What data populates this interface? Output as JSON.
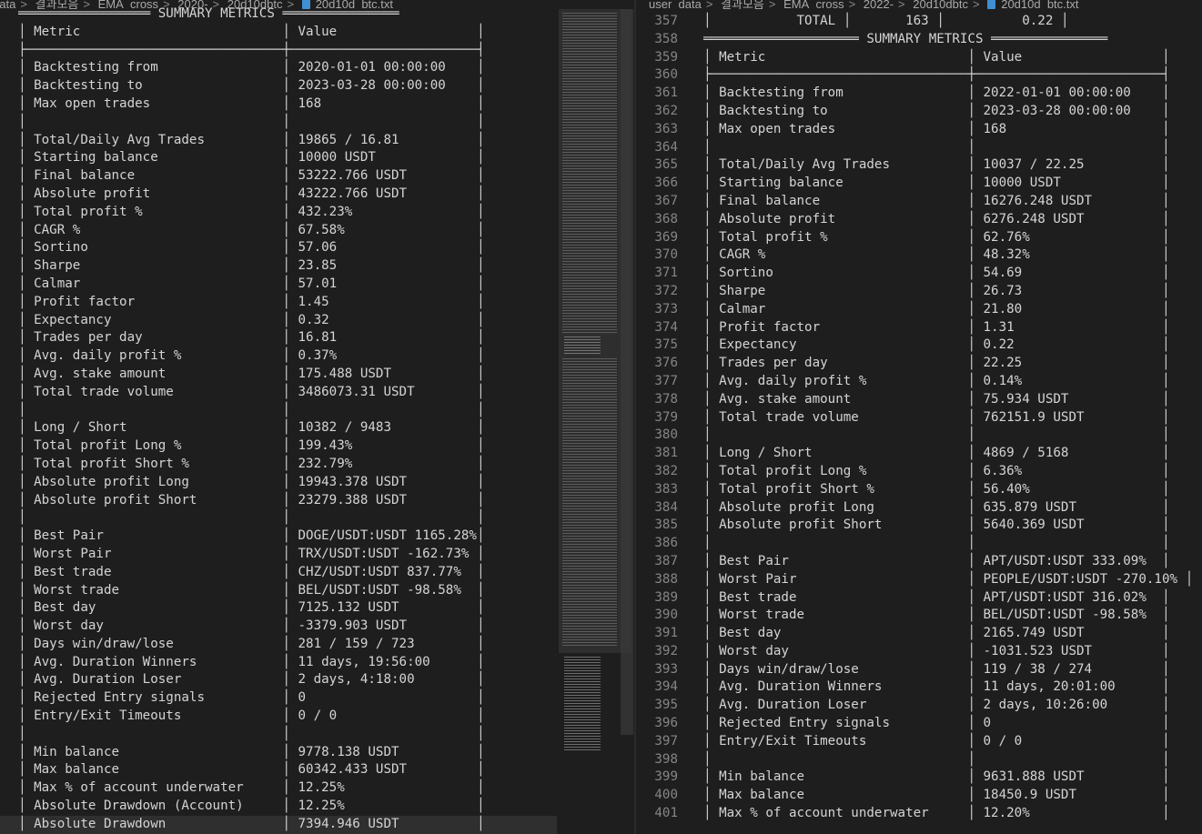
{
  "left_pane": {
    "breadcrumb": [
      "data",
      "결과모음",
      "EMA_cross",
      "2020-",
      "20d10dbtc"
    ],
    "file": "20d10d_btc.txt",
    "lines": [
      "═════════════════ SUMMARY METRICS ═══════════════",
      "│ Metric                          │ Value                  │",
      "├─────────────────────────────────┼────────────────────────┤",
      "│ Backtesting from                │ 2020-01-01 00:00:00    │",
      "│ Backtesting to                  │ 2023-03-28 00:00:00    │",
      "│ Max open trades                 │ 168                    │",
      "│                                 │                        │",
      "│ Total/Daily Avg Trades          │ 19865 / 16.81          │",
      "│ Starting balance                │ 10000 USDT             │",
      "│ Final balance                   │ 53222.766 USDT         │",
      "│ Absolute profit                 │ 43222.766 USDT         │",
      "│ Total profit %                  │ 432.23%                │",
      "│ CAGR %                          │ 67.58%                 │",
      "│ Sortino                         │ 57.06                  │",
      "│ Sharpe                          │ 23.85                  │",
      "│ Calmar                          │ 57.01                  │",
      "│ Profit factor                   │ 1.45                   │",
      "│ Expectancy                      │ 0.32                   │",
      "│ Trades per day                  │ 16.81                  │",
      "│ Avg. daily profit %             │ 0.37%                  │",
      "│ Avg. stake amount               │ 175.488 USDT           │",
      "│ Total trade volume              │ 3486073.31 USDT        │",
      "│                                 │                        │",
      "│ Long / Short                    │ 10382 / 9483           │",
      "│ Total profit Long %             │ 199.43%                │",
      "│ Total profit Short %            │ 232.79%                │",
      "│ Absolute profit Long            │ 19943.378 USDT         │",
      "│ Absolute profit Short           │ 23279.388 USDT         │",
      "│                                 │                        │",
      "│ Best Pair                       │ DOGE/USDT:USDT 1165.28%│",
      "│ Worst Pair                      │ TRX/USDT:USDT -162.73% │",
      "│ Best trade                      │ CHZ/USDT:USDT 837.77%  │",
      "│ Worst trade                     │ BEL/USDT:USDT -98.58%  │",
      "│ Best day                        │ 7125.132 USDT          │",
      "│ Worst day                       │ -3379.903 USDT         │",
      "│ Days win/draw/lose              │ 281 / 159 / 723        │",
      "│ Avg. Duration Winners           │ 11 days, 19:56:00      │",
      "│ Avg. Duration Loser             │ 2 days, 4:18:00        │",
      "│ Rejected Entry signals          │ 0                      │",
      "│ Entry/Exit Timeouts             │ 0 / 0                  │",
      "│                                 │                        │",
      "│ Min balance                     │ 9778.138 USDT          │",
      "│ Max balance                     │ 60342.433 USDT         │",
      "│ Max % of account underwater     │ 12.25%                 │",
      "│ Absolute Drawdown (Account)     │ 12.25%                 │",
      "│ Absolute Drawdown               │ 7394.946 USDT          │"
    ]
  },
  "right_pane": {
    "breadcrumb": [
      "user_data",
      "결과모음",
      "EMA_cross",
      "2022-",
      "20d10dbtc"
    ],
    "file": "20d10d_btc.txt",
    "line_numbers": [
      "357",
      "358",
      "359",
      "360",
      "361",
      "362",
      "363",
      "364",
      "365",
      "366",
      "367",
      "368",
      "369",
      "370",
      "371",
      "372",
      "373",
      "374",
      "375",
      "376",
      "377",
      "378",
      "379",
      "380",
      "381",
      "382",
      "383",
      "384",
      "385",
      "386",
      "387",
      "388",
      "389",
      "390",
      "391",
      "392",
      "393",
      "394",
      "395",
      "396",
      "397",
      "398",
      "399",
      "400",
      "401"
    ],
    "lines": [
      "│           TOTAL │       163 │          0.22 │",
      "════════════════════ SUMMARY METRICS ═══════════════",
      "│ Metric                          │ Value                  │",
      "├─────────────────────────────────┼────────────────────────┤",
      "│ Backtesting from                │ 2022-01-01 00:00:00    │",
      "│ Backtesting to                  │ 2023-03-28 00:00:00    │",
      "│ Max open trades                 │ 168                    │",
      "│                                 │                        │",
      "│ Total/Daily Avg Trades          │ 10037 / 22.25          │",
      "│ Starting balance                │ 10000 USDT             │",
      "│ Final balance                   │ 16276.248 USDT         │",
      "│ Absolute profit                 │ 6276.248 USDT          │",
      "│ Total profit %                  │ 62.76%                 │",
      "│ CAGR %                          │ 48.32%                 │",
      "│ Sortino                         │ 54.69                  │",
      "│ Sharpe                          │ 26.73                  │",
      "│ Calmar                          │ 21.80                  │",
      "│ Profit factor                   │ 1.31                   │",
      "│ Expectancy                      │ 0.22                   │",
      "│ Trades per day                  │ 22.25                  │",
      "│ Avg. daily profit %             │ 0.14%                  │",
      "│ Avg. stake amount               │ 75.934 USDT            │",
      "│ Total trade volume              │ 762151.9 USDT          │",
      "│                                 │                        │",
      "│ Long / Short                    │ 4869 / 5168            │",
      "│ Total profit Long %             │ 6.36%                  │",
      "│ Total profit Short %            │ 56.40%                 │",
      "│ Absolute profit Long            │ 635.879 USDT           │",
      "│ Absolute profit Short           │ 5640.369 USDT          │",
      "│                                 │                        │",
      "│ Best Pair                       │ APT/USDT:USDT 333.09%  │",
      "│ Worst Pair                      │ PEOPLE/USDT:USDT -270.10% │",
      "│ Best trade                      │ APT/USDT:USDT 316.02%  │",
      "│ Worst trade                     │ BEL/USDT:USDT -98.58%  │",
      "│ Best day                        │ 2165.749 USDT          │",
      "│ Worst day                       │ -1031.523 USDT         │",
      "│ Days win/draw/lose              │ 119 / 38 / 274         │",
      "│ Avg. Duration Winners           │ 11 days, 20:01:00      │",
      "│ Avg. Duration Loser             │ 2 days, 10:26:00       │",
      "│ Rejected Entry signals          │ 0                      │",
      "│ Entry/Exit Timeouts             │ 0 / 0                  │",
      "│                                 │                        │",
      "│ Min balance                     │ 9631.888 USDT          │",
      "│ Max balance                     │ 18450.9 USDT           │",
      "│ Max % of account underwater     │ 12.20%                 │"
    ]
  }
}
